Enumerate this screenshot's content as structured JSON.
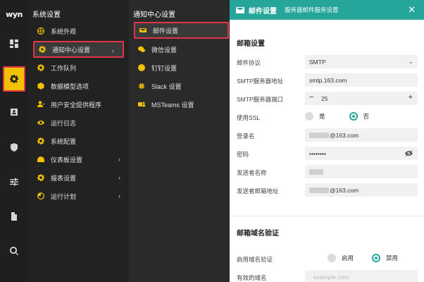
{
  "logo": "wyn",
  "rail": {
    "items": [
      {
        "icon": "dashboard-grid-icon"
      },
      {
        "icon": "gear-icon",
        "active": true
      },
      {
        "icon": "id-card-icon"
      },
      {
        "icon": "shield-icon"
      },
      {
        "icon": "sliders-icon"
      },
      {
        "icon": "document-icon"
      },
      {
        "icon": "search-icon"
      }
    ],
    "active_color": "#f2c200",
    "highlight_color": "#e3344a"
  },
  "col1": {
    "title": "系统设置",
    "items": [
      {
        "label": "系统外观",
        "icon": "globe-icon"
      },
      {
        "label": "通知中心设置",
        "icon": "gear-icon",
        "selected": true,
        "has_children": true
      },
      {
        "label": "工作队列",
        "icon": "gear-icon"
      },
      {
        "label": "数据模型选项",
        "icon": "cube-icon"
      },
      {
        "label": "用户安全提供程序",
        "icon": "user-key-icon"
      },
      {
        "label": "运行日志",
        "icon": "eye-icon"
      },
      {
        "label": "系统配置",
        "icon": "gear-icon"
      },
      {
        "label": "仪表板设置",
        "icon": "dashboard-icon",
        "has_children": true
      },
      {
        "label": "报表设置",
        "icon": "gear-icon",
        "has_children": true
      },
      {
        "label": "运行计划",
        "icon": "clock-icon",
        "has_children": true
      }
    ]
  },
  "col2": {
    "title": "通知中心设置",
    "items": [
      {
        "label": "邮件设置",
        "icon": "mail-icon",
        "selected": true
      },
      {
        "label": "微信设置",
        "icon": "wechat-icon"
      },
      {
        "label": "钉钉设置",
        "icon": "dingtalk-icon"
      },
      {
        "label": "Slack 设置",
        "icon": "slack-icon"
      },
      {
        "label": "MSTeams 设置",
        "icon": "teams-icon"
      }
    ]
  },
  "panel": {
    "header_title": "邮件设置",
    "header_subtitle": "服务器邮件服务设置",
    "accent": "#26a69a",
    "section1_title": "邮箱设置",
    "protocol": {
      "label": "邮件协议",
      "value": "SMTP"
    },
    "smtp_server": {
      "label": "SMTP服务器地址",
      "value": "smtp.163.com"
    },
    "smtp_port": {
      "label": "SMTP服务器端口",
      "value": "25",
      "minus": "−",
      "plus": "+"
    },
    "ssl": {
      "label": "使用SSL",
      "yes": "是",
      "no": "否",
      "selected": "否"
    },
    "login": {
      "label": "登录名",
      "value": "@163.com"
    },
    "password": {
      "label": "密码",
      "value": "••••••••"
    },
    "sender_name": {
      "label": "发送者名称"
    },
    "sender_email": {
      "label": "发送者邮箱地址",
      "value": "@163.com"
    },
    "section2_title": "邮箱域名验证",
    "domain_check": {
      "label": "启用域名验证",
      "enable": "启用",
      "disable": "禁用",
      "selected": "禁用"
    },
    "valid_domain": {
      "label": "有效的域名",
      "placeholder": "example.com"
    }
  }
}
